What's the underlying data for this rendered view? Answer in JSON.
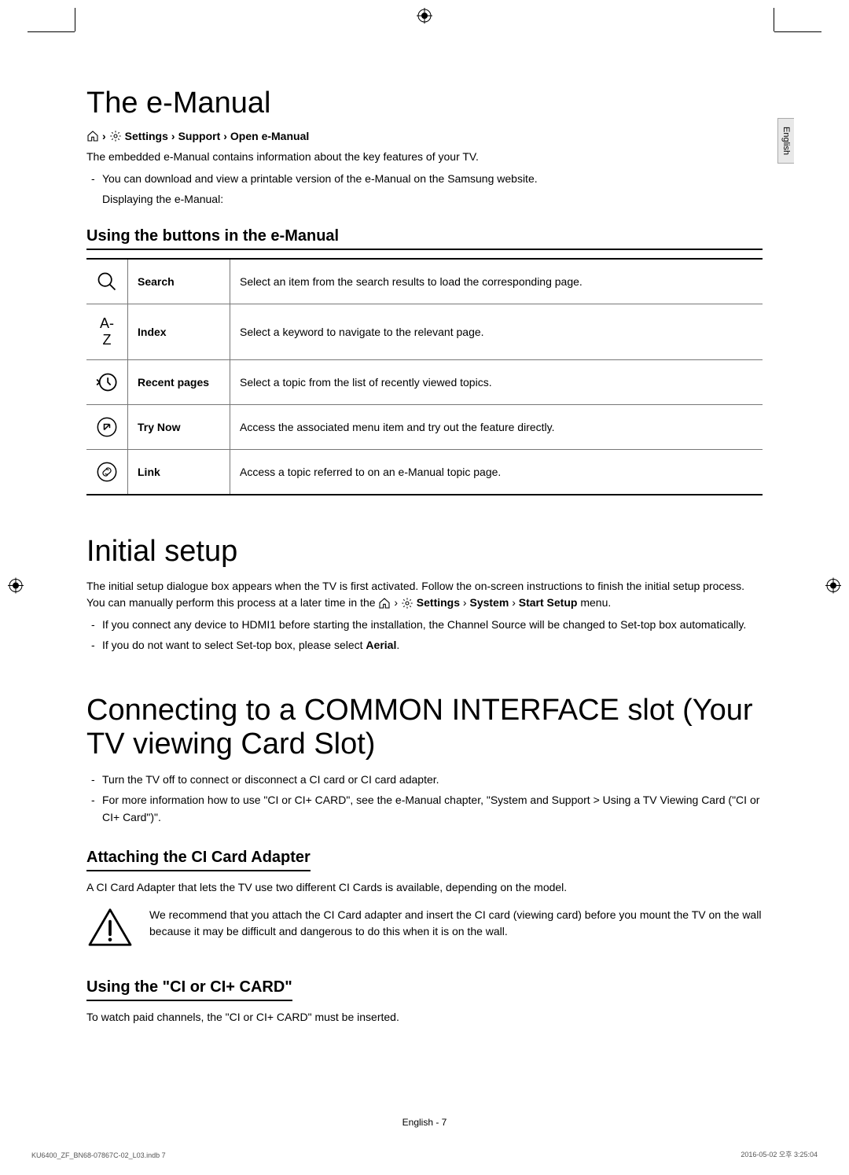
{
  "side_tab": "English",
  "section_emanual": {
    "title": "The e-Manual",
    "breadcrumb_parts": [
      "Settings",
      "Support",
      "Open e-Manual"
    ],
    "intro": "The embedded e-Manual contains information about the key features of your TV.",
    "note1": "You can download and view a printable version of the e-Manual on the Samsung website.",
    "note1_sub": "Displaying the e-Manual:",
    "subhead": "Using the buttons in the e-Manual",
    "rows": [
      {
        "label": "Search",
        "desc": "Select an item from the search results to load the corresponding page."
      },
      {
        "label": "Index",
        "desc": "Select a keyword to navigate to the relevant page."
      },
      {
        "label": "Recent pages",
        "desc": "Select a topic from the list of recently viewed topics."
      },
      {
        "label": "Try Now",
        "desc": "Access the associated menu item and try out the feature directly."
      },
      {
        "label": "Link",
        "desc": "Access a topic referred to on an e-Manual topic page."
      }
    ]
  },
  "section_initial": {
    "title": "Initial setup",
    "body_pre": "The initial setup dialogue box appears when the TV is first activated. Follow the on-screen instructions to finish the initial setup process. You can manually perform this process at a later time in the ",
    "breadcrumb_parts": [
      "Settings",
      "System",
      "Start Setup"
    ],
    "body_post": " menu.",
    "note1": "If you connect any device to HDMI1 before starting the installation, the Channel Source will be changed to Set-top box automatically.",
    "note2_pre": "If you do not want to select Set-top box, please select ",
    "note2_bold": "Aerial",
    "note2_post": "."
  },
  "section_ci": {
    "title": "Connecting to a COMMON INTERFACE slot (Your TV viewing Card Slot)",
    "note1": "Turn the TV off to connect or disconnect a CI card or CI card adapter.",
    "note2": "For more information how to use \"CI or CI+ CARD\", see the e-Manual chapter, \"System and Support > Using a TV Viewing Card (\"CI or CI+ Card\")\".",
    "sub1_head": "Attaching the CI Card Adapter",
    "sub1_body": "A CI Card Adapter that lets the TV use two different CI Cards is available, depending on the model.",
    "warning": "We recommend that you attach the CI Card adapter and insert the CI card (viewing card) before you mount the TV on the wall because it may be difficult and dangerous to do this when it is on the wall.",
    "sub2_head": "Using the \"CI or CI+ CARD\"",
    "sub2_body": "To watch paid channels, the \"CI or CI+ CARD\" must be inserted."
  },
  "footer": {
    "center": "English - 7",
    "left": "KU6400_ZF_BN68-07867C-02_L03.indb   7",
    "right": "2016-05-02   오후 3:25:04"
  }
}
